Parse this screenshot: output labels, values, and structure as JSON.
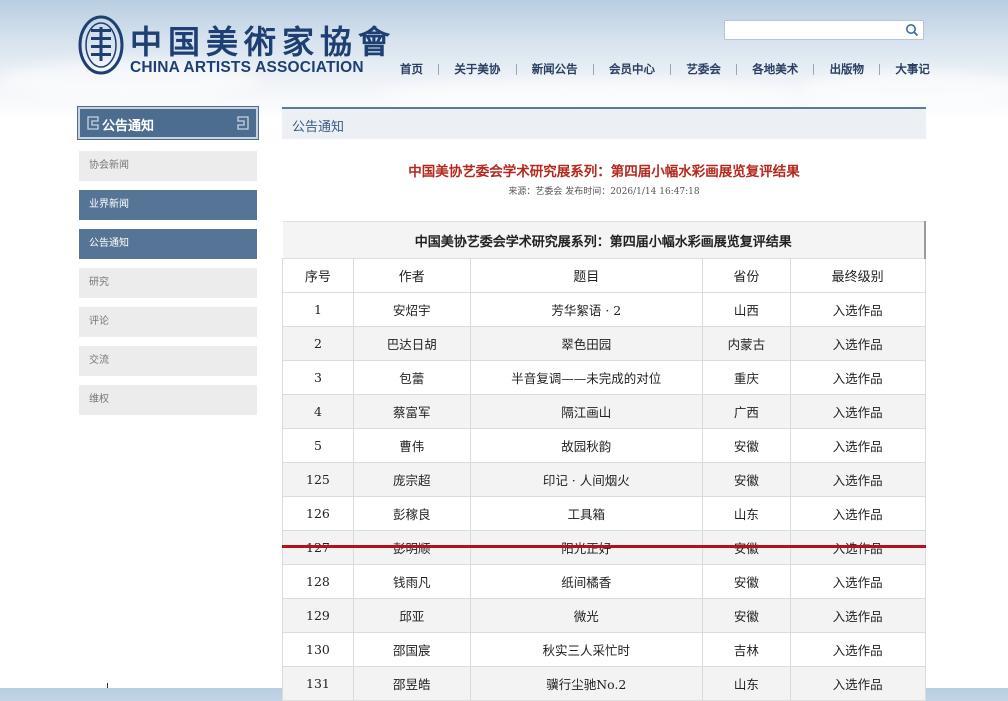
{
  "header": {
    "logo_cn": "中国美術家協會",
    "logo_en": "CHINA ARTISTS ASSOCIATION",
    "search": {
      "placeholder": "",
      "value": ""
    },
    "nav": [
      "首页",
      "关于美协",
      "新闻公告",
      "会员中心",
      "艺委会",
      "各地美术",
      "出版物",
      "大事记"
    ]
  },
  "sidebar": {
    "title": "公告通知",
    "items": [
      {
        "label": "协会新闻",
        "active": false
      },
      {
        "label": "业界新闻",
        "active": true
      },
      {
        "label": "公告通知",
        "active": true
      },
      {
        "label": "研究",
        "active": false
      },
      {
        "label": "评论",
        "active": false
      },
      {
        "label": "交流",
        "active": false
      },
      {
        "label": "维权",
        "active": false
      }
    ]
  },
  "main": {
    "breadcrumb": "公告通知",
    "article_title": "中国美协艺委会学术研究展系列：第四届小幅水彩画展览复评结果",
    "article_meta": "来源：艺委会 发布时间：2026/1/14 16:47:18",
    "table": {
      "caption": "中国美协艺委会学术研究展系列：第四届小幅水彩画展览复评结果",
      "headers": [
        "序号",
        "作者",
        "题目",
        "省份",
        "最终级别"
      ],
      "rows": [
        [
          "1",
          "安炤宇",
          "芳华絮语 · 2",
          "山西",
          "入选作品"
        ],
        [
          "2",
          "巴达日胡",
          "翠色田园",
          "内蒙古",
          "入选作品"
        ],
        [
          "3",
          "包蕾",
          "半音复调——未完成的对位",
          "重庆",
          "入选作品"
        ],
        [
          "4",
          "蔡富军",
          "隔江画山",
          "广西",
          "入选作品"
        ],
        [
          "5",
          "曹伟",
          "故园秋韵",
          "安徽",
          "入选作品"
        ],
        [
          "125",
          "庞宗超",
          "印记 · 人间烟火",
          "安徽",
          "入选作品"
        ],
        [
          "126",
          "彭稼良",
          "工具箱",
          "山东",
          "入选作品"
        ],
        [
          "127",
          "彭明顺",
          "阳光正好",
          "安徽",
          "入选作品"
        ],
        [
          "128",
          "钱雨凡",
          "纸间橘香",
          "安徽",
          "入选作品"
        ],
        [
          "129",
          "邱亚",
          "微光",
          "安徽",
          "入选作品"
        ],
        [
          "130",
          "邵国宸",
          "秋实三人采忙时",
          "吉林",
          "入选作品"
        ],
        [
          "131",
          "邵昱皓",
          "骥行尘驰No.2",
          "山东",
          "入选作品"
        ]
      ]
    }
  },
  "colors": {
    "accent_red": "#b3121b",
    "nav_blue": "#2a3f62",
    "sidebar_active": "#557496"
  }
}
